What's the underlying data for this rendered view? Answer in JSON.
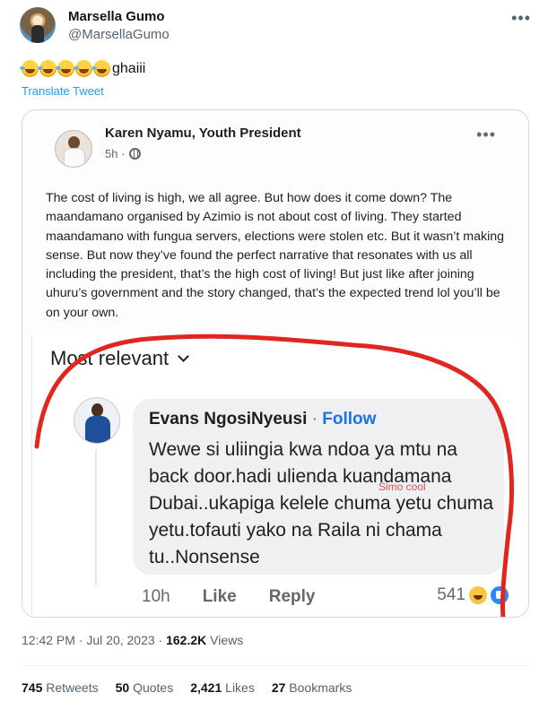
{
  "tweet": {
    "author": {
      "display_name": "Marsella Gumo",
      "handle": "@MarsellaGumo"
    },
    "more_label": "•••",
    "emojis": [
      "rolling-on-floor-laughing",
      "rolling-on-floor-laughing",
      "rolling-on-floor-laughing",
      "rolling-on-floor-laughing",
      "rolling-on-floor-laughing"
    ],
    "text": "ghaiii",
    "translate_label": "Translate Tweet",
    "timestamp": "12:42 PM · Jul 20, 2023 · ",
    "views_count": "162.2K",
    "views_label": " Views",
    "stats": {
      "retweets_count": "745",
      "retweets_label": " Retweets",
      "quotes_count": "50",
      "quotes_label": " Quotes",
      "likes_count": "2,421",
      "likes_label": " Likes",
      "bookmarks_count": "27",
      "bookmarks_label": " Bookmarks"
    }
  },
  "embedded_post": {
    "author": "Karen Nyamu, Youth President",
    "time": "5h ·",
    "more_label": "•••",
    "body": "The cost of living is high, we all agree. But how does it come down? The maandamano organised by Azimio is not about cost of living. They started maandamano with fungua servers, elections were stolen etc. But it wasn’t making sense. But now they’ve found the perfect narrative that resonates with us all including the president, that’s the high cost of living! But just like after joining uhuru’s government and the story changed, that’s the expected trend lol you’ll be on your own.",
    "sort_label": "Most relevant",
    "comment": {
      "author": "Evans NgosiNyeusi",
      "separator": " · ",
      "follow_label": "Follow",
      "text": "Wewe si uliingia kwa ndoa ya mtu na back door.hadi ulienda kuandamana Dubai..ukapiga kelele chuma yetu chuma yetu.tofauti yako na Raila ni chama tu..Nonsense",
      "watermark": "Simo cool",
      "time": "10h",
      "like_label": "Like",
      "reply_label": "Reply",
      "reaction_count": "541"
    }
  },
  "colors": {
    "link": "#1d9bf0",
    "scribble": "#e0261f",
    "follow": "#1a73e8"
  }
}
